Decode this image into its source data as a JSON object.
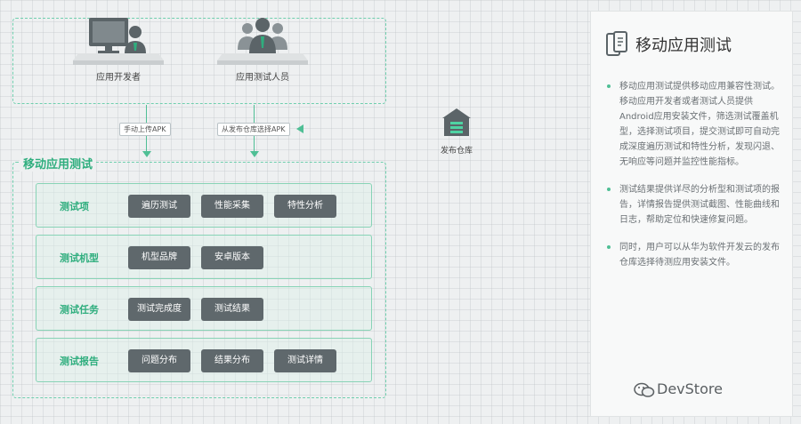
{
  "actors": {
    "developer": "应用开发者",
    "tester": "应用测试人员"
  },
  "arrows": {
    "upload": "手动上传APK",
    "select_from_repo": "从发布仓库选择APK"
  },
  "repository": {
    "label": "发布仓库"
  },
  "main": {
    "title": "移动应用测试",
    "rows": [
      {
        "label": "测试项",
        "chips": [
          "遍历测试",
          "性能采集",
          "特性分析"
        ]
      },
      {
        "label": "测试机型",
        "chips": [
          "机型品牌",
          "安卓版本"
        ]
      },
      {
        "label": "测试任务",
        "chips": [
          "测试完成度",
          "测试结果"
        ]
      },
      {
        "label": "测试报告",
        "chips": [
          "问题分布",
          "结果分布",
          "测试详情"
        ]
      }
    ]
  },
  "panel": {
    "title": "移动应用测试",
    "bullets": [
      "移动应用测试提供移动应用兼容性测试。移动应用开发者或者测试人员提供Android应用安装文件，筛选测试覆盖机型，选择测试项目，提交测试即可自动完成深度遍历测试和特性分析，发现闪退、无响应等问题并监控性能指标。",
      "测试结果提供详尽的分析型和测试项的报告，详情报告提供测试截图、性能曲线和日志，帮助定位和快速修复问题。",
      "同时，用户可以从华为软件开发云的发布仓库选择待测应用安装文件。"
    ]
  },
  "watermark": "DevStore",
  "colors": {
    "accent": "#2fae7e",
    "chip": "#5f686c",
    "border": "#6fcfae"
  }
}
